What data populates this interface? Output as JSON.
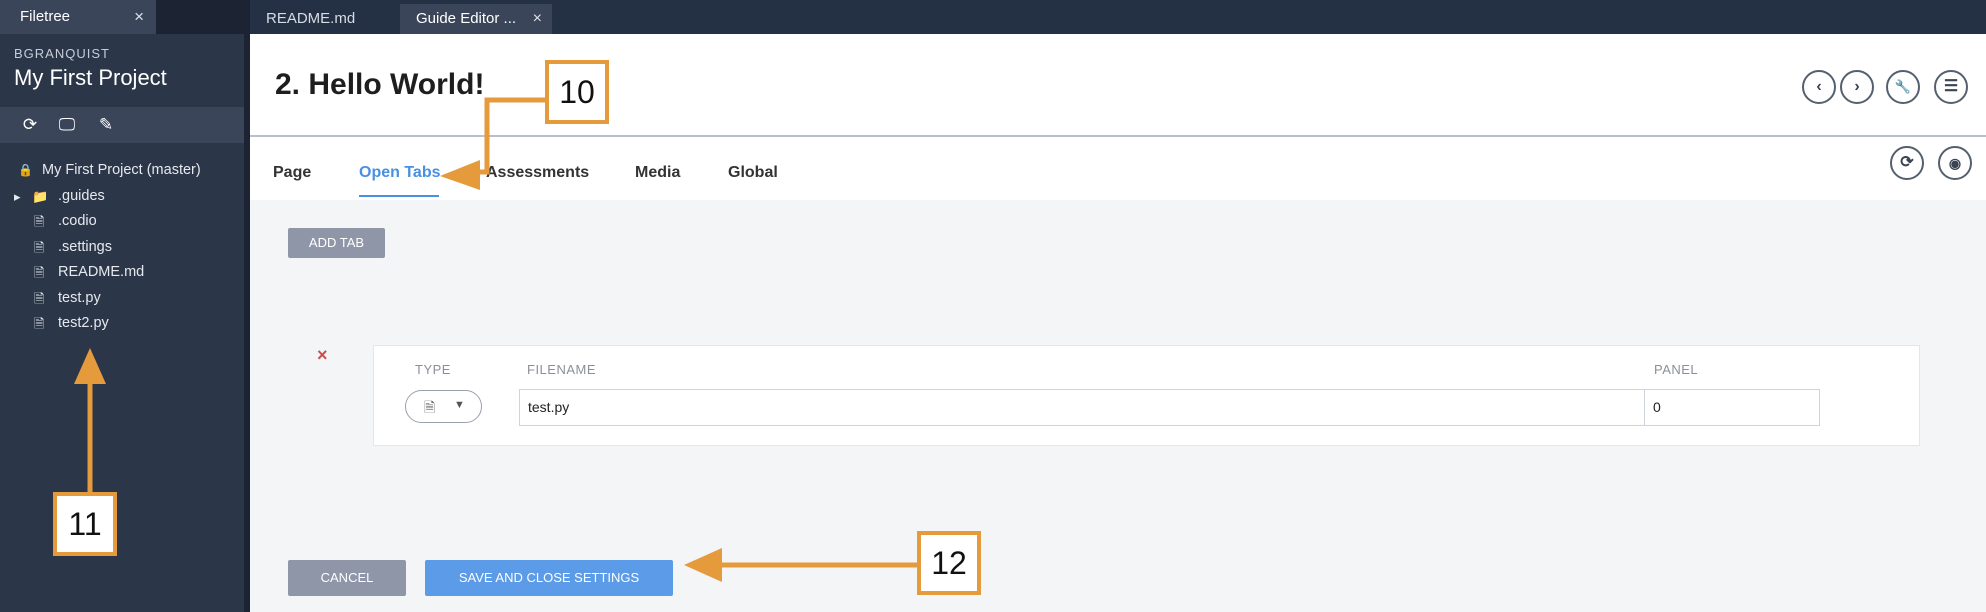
{
  "sidebar": {
    "tab_label": "Filetree",
    "tab_close": "×",
    "user": "BGRANQUIST",
    "project_title": "My First Project",
    "tools": [
      "refresh-icon",
      "deploy-icon",
      "edit-icon"
    ],
    "tree": [
      {
        "label": "My First Project (master)",
        "icon": "lock-icon",
        "glyph": "🔒"
      },
      {
        "label": ".guides",
        "icon": "folder-icon",
        "glyph": "📁",
        "expander": "▸"
      },
      {
        "label": ".codio",
        "icon": "file-icon",
        "glyph": "🗎"
      },
      {
        "label": ".settings",
        "icon": "file-icon",
        "glyph": "🗎"
      },
      {
        "label": "README.md",
        "icon": "file-icon",
        "glyph": "🗎"
      },
      {
        "label": "test.py",
        "icon": "file-icon",
        "glyph": "🗎"
      },
      {
        "label": "test2.py",
        "icon": "file-icon",
        "glyph": "🗎"
      }
    ]
  },
  "editor_tabs": [
    {
      "label": "README.md",
      "active": false
    },
    {
      "label": "Guide Editor ...",
      "active": true,
      "close": "×"
    }
  ],
  "main": {
    "title": "2. Hello World!",
    "header_buttons": [
      "prev-icon",
      "next-icon",
      "wrench-icon",
      "list-icon"
    ],
    "header_glyphs": [
      "‹",
      "›",
      "🔧",
      "☰"
    ],
    "nav_tabs": [
      "Page",
      "Open Tabs",
      "Assessments",
      "Media",
      "Global"
    ],
    "active_tab": "Open Tabs",
    "panel_buttons": [
      "refresh-icon",
      "eye-icon"
    ],
    "panel_glyphs": [
      "⟳",
      "◉"
    ],
    "add_tab_label": "ADD TAB",
    "remove_glyph": "×",
    "columns": {
      "type": "TYPE",
      "filename": "FILENAME",
      "panel": "PANEL"
    },
    "row": {
      "type_icon": "file-icon",
      "type_glyph": "🗎",
      "caret": "▼",
      "filename": "test.py",
      "panel": "0"
    },
    "cancel_label": "CANCEL",
    "save_label": "SAVE AND CLOSE SETTINGS"
  },
  "annotations": {
    "a10": "10",
    "a11": "11",
    "a12": "12"
  },
  "colors": {
    "accent": "#4a90e2",
    "annotation": "#e59a3c",
    "sidebar": "#2b3649"
  }
}
